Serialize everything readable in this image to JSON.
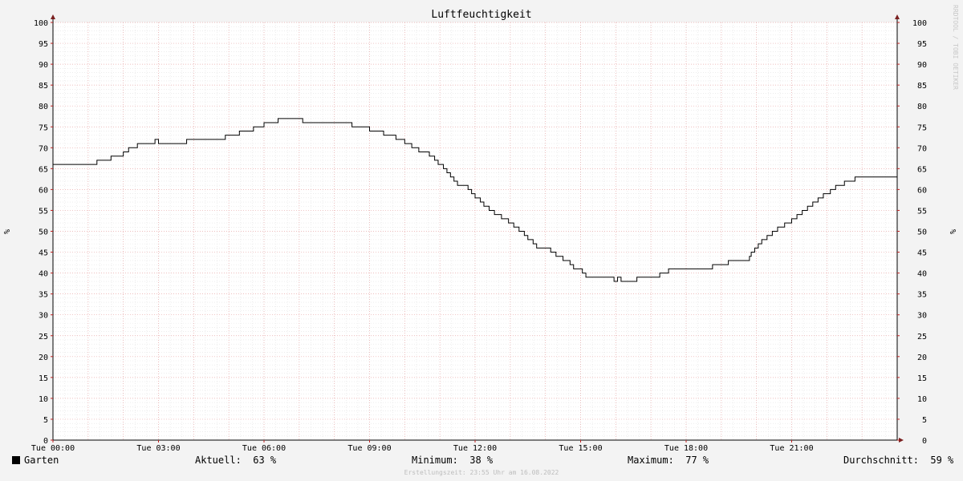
{
  "chart_data": {
    "type": "line",
    "title": "Luftfeuchtigkeit",
    "ylabel": "%",
    "xlabel": "",
    "ylim": [
      0,
      100
    ],
    "yticks": [
      0,
      5,
      10,
      15,
      20,
      25,
      30,
      35,
      40,
      45,
      50,
      55,
      60,
      65,
      70,
      75,
      80,
      85,
      90,
      95,
      100
    ],
    "xticks": [
      "Tue 00:00",
      "Tue 03:00",
      "Tue 06:00",
      "Tue 09:00",
      "Tue 12:00",
      "Tue 15:00",
      "Tue 18:00",
      "Tue 21:00"
    ],
    "x_unit": "hours",
    "xlim": [
      0,
      24
    ],
    "grid": true,
    "series": [
      {
        "name": "Garten",
        "color": "#000000",
        "points": [
          [
            0.0,
            66
          ],
          [
            1.25,
            67
          ],
          [
            1.65,
            68
          ],
          [
            2.0,
            69
          ],
          [
            2.15,
            70
          ],
          [
            2.4,
            71
          ],
          [
            2.9,
            72
          ],
          [
            3.0,
            71
          ],
          [
            3.8,
            72
          ],
          [
            4.9,
            73
          ],
          [
            5.3,
            74
          ],
          [
            5.7,
            75
          ],
          [
            6.0,
            76
          ],
          [
            6.4,
            77
          ],
          [
            7.1,
            76
          ],
          [
            8.5,
            75
          ],
          [
            9.0,
            74
          ],
          [
            9.4,
            73
          ],
          [
            9.75,
            72
          ],
          [
            10.0,
            71
          ],
          [
            10.2,
            70
          ],
          [
            10.4,
            69
          ],
          [
            10.7,
            68
          ],
          [
            10.85,
            67
          ],
          [
            10.95,
            66
          ],
          [
            11.1,
            65
          ],
          [
            11.2,
            64
          ],
          [
            11.3,
            63
          ],
          [
            11.4,
            62
          ],
          [
            11.5,
            61
          ],
          [
            11.8,
            60
          ],
          [
            11.9,
            59
          ],
          [
            12.0,
            58
          ],
          [
            12.15,
            57
          ],
          [
            12.25,
            56
          ],
          [
            12.4,
            55
          ],
          [
            12.55,
            54
          ],
          [
            12.75,
            53
          ],
          [
            12.95,
            52
          ],
          [
            13.1,
            51
          ],
          [
            13.25,
            50
          ],
          [
            13.4,
            49
          ],
          [
            13.5,
            48
          ],
          [
            13.65,
            47
          ],
          [
            13.75,
            46
          ],
          [
            14.15,
            45
          ],
          [
            14.3,
            44
          ],
          [
            14.5,
            43
          ],
          [
            14.7,
            42
          ],
          [
            14.8,
            41
          ],
          [
            15.05,
            40
          ],
          [
            15.15,
            39
          ],
          [
            15.95,
            38
          ],
          [
            16.05,
            39
          ],
          [
            16.15,
            38
          ],
          [
            16.6,
            39
          ],
          [
            17.25,
            40
          ],
          [
            17.5,
            41
          ],
          [
            18.75,
            42
          ],
          [
            19.2,
            43
          ],
          [
            19.8,
            44
          ],
          [
            19.85,
            45
          ],
          [
            19.95,
            46
          ],
          [
            20.05,
            47
          ],
          [
            20.15,
            48
          ],
          [
            20.3,
            49
          ],
          [
            20.45,
            50
          ],
          [
            20.6,
            51
          ],
          [
            20.8,
            52
          ],
          [
            21.0,
            53
          ],
          [
            21.15,
            54
          ],
          [
            21.3,
            55
          ],
          [
            21.45,
            56
          ],
          [
            21.6,
            57
          ],
          [
            21.75,
            58
          ],
          [
            21.9,
            59
          ],
          [
            22.1,
            60
          ],
          [
            22.25,
            61
          ],
          [
            22.5,
            62
          ],
          [
            22.8,
            63
          ],
          [
            24.0,
            63
          ]
        ]
      }
    ]
  },
  "legend": {
    "series_name": "Garten",
    "aktuell_label": "Aktuell:",
    "aktuell_value": "63 %",
    "minimum_label": "Minimum:",
    "minimum_value": "38 %",
    "maximum_label": "Maximum:",
    "maximum_value": "77 %",
    "durchschnitt_label": "Durchschnitt:",
    "durchschnitt_value": "59 %"
  },
  "footer": "Erstellungszeit: 23:55 Uhr am 16.08.2022",
  "watermark": "RRDTOOL / TOBI OETIKER"
}
